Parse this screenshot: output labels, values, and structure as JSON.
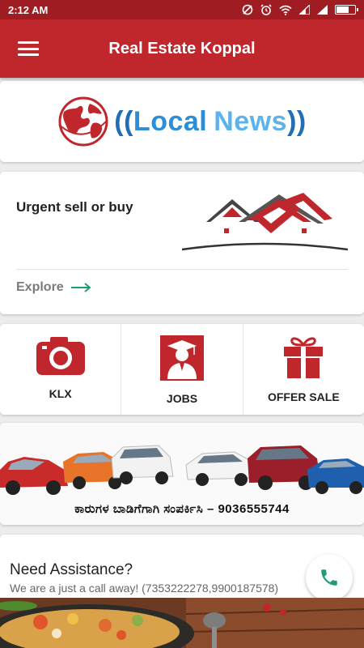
{
  "status_bar": {
    "time": "2:12 AM"
  },
  "app_bar": {
    "title": "Real Estate Koppal",
    "menu_icon": "hamburger-icon"
  },
  "news_banner": {
    "word_local": "Local",
    "word_news": "News",
    "open_paren": "((",
    "close_paren": "))"
  },
  "sell_card": {
    "title": "Urgent sell or buy",
    "explore_label": "Explore"
  },
  "categories": [
    {
      "label": "KLX",
      "icon": "camera-icon"
    },
    {
      "label": "JOBS",
      "icon": "graduate-icon"
    },
    {
      "label": "OFFER SALE",
      "icon": "gift-icon"
    }
  ],
  "cars_banner": {
    "caption": "ಕಾರುಗಳ ಬಾಡಿಗೆಗಾಗಿ ಸಂಪರ್ಕಿಸಿ – 9036555744"
  },
  "assistance": {
    "title": "Need Assistance?",
    "subtitle": "We are a just a call away! (7353222278,9900187578)",
    "call_icon": "phone-icon"
  },
  "colors": {
    "brand": "#c0272d",
    "status_bar": "#9e1c22",
    "accent_green": "#1f9b78",
    "news_blue": "#2b8ed9"
  }
}
